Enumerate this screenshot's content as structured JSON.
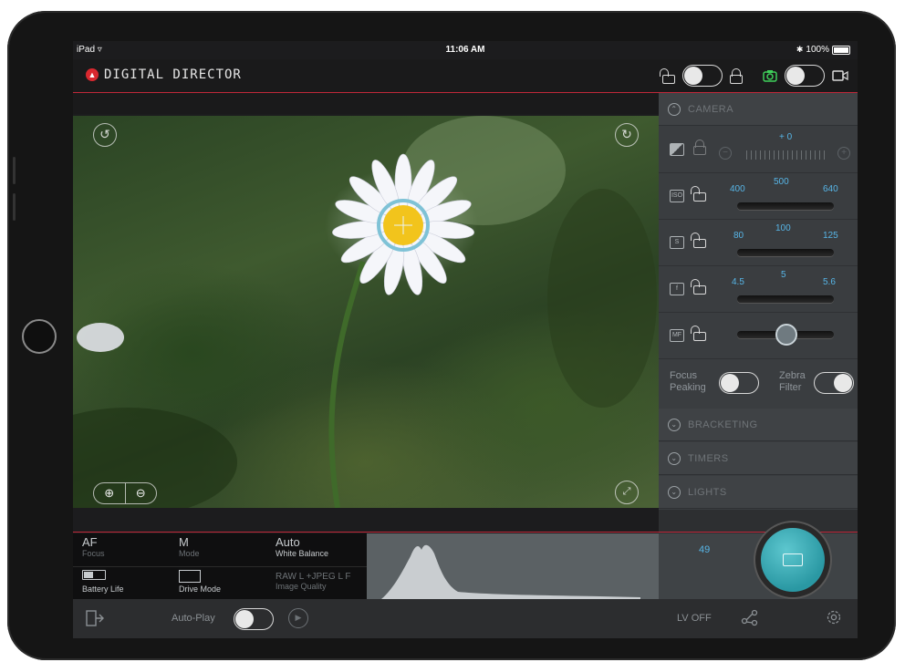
{
  "status_bar": {
    "device": "iPad",
    "time": "11:06 AM",
    "battery": "100%"
  },
  "app": {
    "title": "DIGITAL DIRECTOR"
  },
  "sections": {
    "camera": "CAMERA",
    "bracketing": "BRACKETING",
    "timers": "TIMERS",
    "lights": "LIGHTS"
  },
  "controls": {
    "exposure_comp": {
      "value": "+ 0"
    },
    "iso": {
      "low": "400",
      "value": "500",
      "high": "640"
    },
    "shutter": {
      "low": "80",
      "value": "100",
      "high": "125"
    },
    "aperture": {
      "low": "4.5",
      "value": "5",
      "high": "5.6"
    },
    "focus_peaking_label": "Focus Peaking",
    "zebra_filter_label": "Zebra Filter"
  },
  "info": {
    "af": "AF",
    "focus_label": "Focus",
    "m": "M",
    "mode_label": "Mode",
    "auto": "Auto",
    "wb_label": "White Balance",
    "battery_label": "Battery Life",
    "drive_label": "Drive Mode",
    "quality_value": "RAW L +JPEG L F",
    "quality_label": "Image Quality"
  },
  "histogram": {
    "value": "49"
  },
  "footer": {
    "autoplay_label": "Auto-Play",
    "lv_label": "LV OFF"
  },
  "icons": [
    "wifi-icon",
    "bluetooth-icon",
    "rotate-left-icon",
    "rotate-right-icon",
    "zoom-in-icon",
    "zoom-out-icon",
    "fullscreen-icon",
    "focus-point-icon",
    "play-icon",
    "share-icon",
    "settings-icon",
    "camera-mode-icon",
    "video-mode-icon"
  ],
  "colors": {
    "accent_red": "#c0283a",
    "value_blue": "#57b5e6",
    "shutter_teal": "#2a98a3",
    "camera_green": "#3ecf5a"
  }
}
